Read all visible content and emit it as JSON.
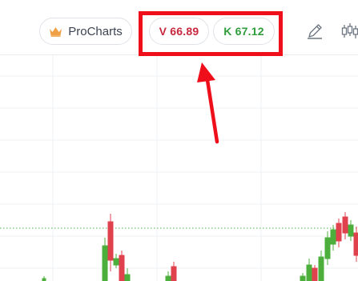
{
  "toolbar": {
    "procharts_label": "ProCharts",
    "sell_price": "V 66.89",
    "buy_price": "K 67.12"
  },
  "icons": {
    "procharts": "crown-icon",
    "draw": "pencil-icon",
    "chart_type": "candlestick-icon"
  },
  "colors": {
    "sell": "#c8283d",
    "buy": "#2f9d3c",
    "annotation": "#ee0f1a",
    "bull_candle": "#4caf3c",
    "bear_candle": "#e0424d",
    "crown": "#f0a046",
    "current_price_line": "#46b04a"
  }
}
